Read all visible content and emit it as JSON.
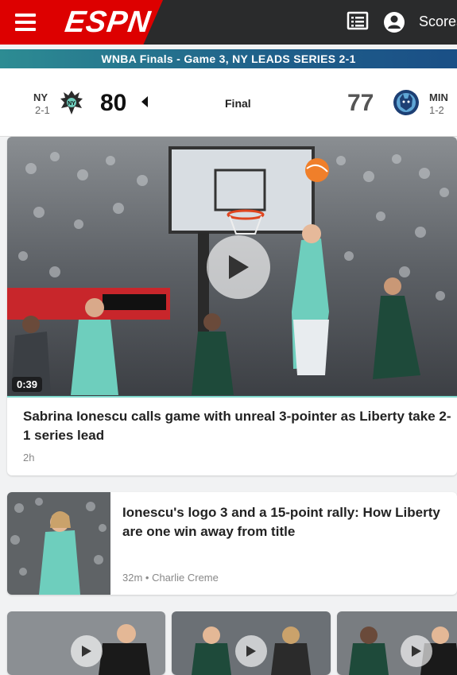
{
  "header": {
    "logo_text": "ESPN",
    "scores_label": "Scores",
    "accent_color": "#dd0000"
  },
  "series_banner": {
    "text": "WNBA Finals - Game 3, NY LEADS SERIES 2-1"
  },
  "scoreboard": {
    "away": {
      "abbr": "NY",
      "record": "2-1",
      "score": "80",
      "winner": true
    },
    "home": {
      "abbr": "MIN",
      "record": "1-2",
      "score": "77",
      "winner": false
    },
    "status": "Final"
  },
  "feed": [
    {
      "headline": "Sabrina Ionescu calls game with unreal 3-pointer as Liberty take 2-1 series lead",
      "meta": "2h",
      "duration": "0:39",
      "is_video": true
    },
    {
      "headline": "Ionescu's logo 3 and a 15-point rally: How Liberty are one win away from title",
      "meta": "32m • Charlie Creme",
      "is_video": false
    }
  ]
}
